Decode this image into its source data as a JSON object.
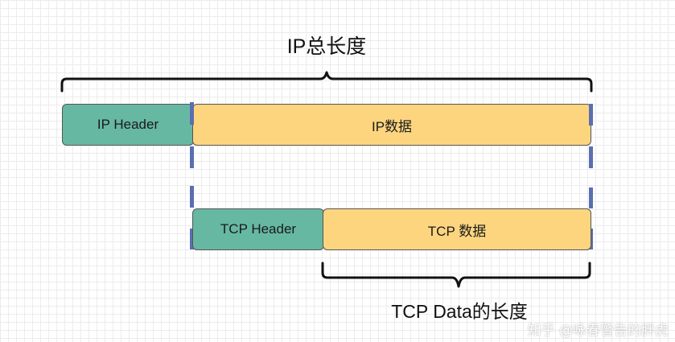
{
  "diagram": {
    "ip_total_length_label": "IP总长度",
    "ip_header_label": "IP Header",
    "ip_data_label": "IP数据",
    "tcp_header_label": "TCP Header",
    "tcp_data_label": "TCP 数据",
    "tcp_data_length_label": "TCP Data的长度"
  },
  "watermark": {
    "text": "知乎 @咏春警告的胖虎"
  },
  "colors": {
    "header_fill": "#66b8a3",
    "data_fill": "#fdd57f",
    "tick": "#5a6fb0",
    "brace": "#111111"
  }
}
